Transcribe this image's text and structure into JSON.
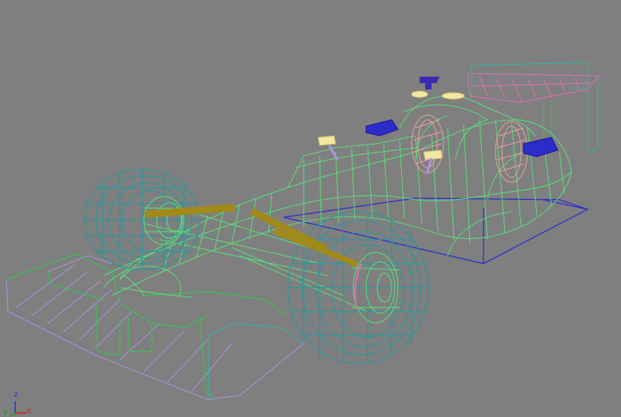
{
  "viewport": {
    "background": "#7f7f7f"
  },
  "axis_gizmo": {
    "z_label": "z",
    "x_label": "x",
    "y_label": "y",
    "colors": {
      "x": "#d21e1e",
      "y": "#1e9e1e",
      "z": "#1e3cd2"
    }
  },
  "wireframe_colors": {
    "body": "#58e27a",
    "tires": "#1e9aa0",
    "floor_purple": "#b090e0",
    "rear_wing": "#e070b0",
    "wishbones": "#a08a1a",
    "mirrors": "#2c2cc8",
    "helmet": "#f2e8a0"
  }
}
